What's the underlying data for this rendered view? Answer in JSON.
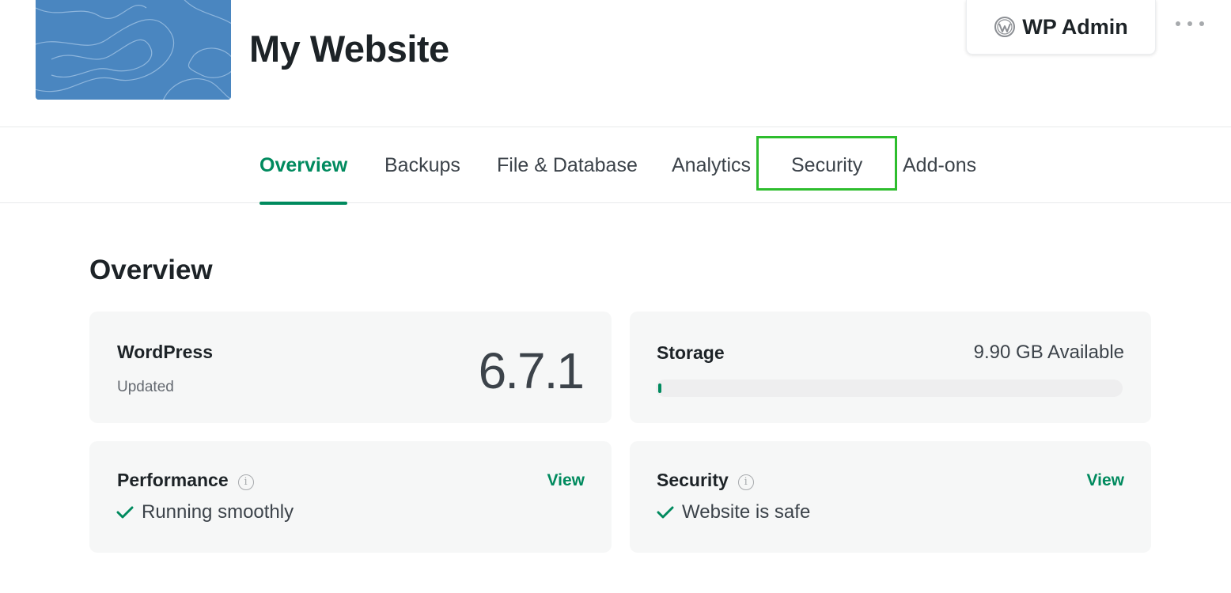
{
  "header": {
    "site_title": "My Website",
    "wp_admin_label": "WP Admin",
    "thumbnail_color": "#4a86c0"
  },
  "tabs": [
    {
      "label": "Overview",
      "active": true
    },
    {
      "label": "Backups",
      "active": false
    },
    {
      "label": "File & Database",
      "active": false
    },
    {
      "label": "Analytics",
      "active": false
    },
    {
      "label": "Security",
      "active": false,
      "highlighted": true
    },
    {
      "label": "Add-ons",
      "active": false
    }
  ],
  "overview": {
    "title": "Overview",
    "wordpress": {
      "label": "WordPress",
      "status": "Updated",
      "version": "6.7.1"
    },
    "storage": {
      "label": "Storage",
      "available": "9.90 GB Available",
      "used_fraction": 0.005
    },
    "performance": {
      "label": "Performance",
      "view_label": "View",
      "status": "Running smoothly"
    },
    "security": {
      "label": "Security",
      "view_label": "View",
      "status": "Website is safe"
    }
  },
  "colors": {
    "accent": "#008a5e",
    "highlight": "#2dbd2d"
  }
}
